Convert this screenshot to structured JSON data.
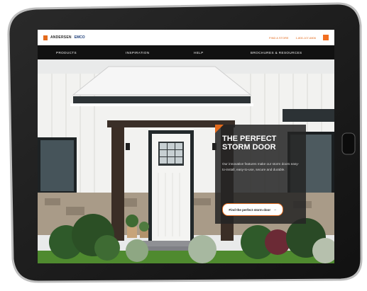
{
  "header": {
    "brand": "ANDERSEN",
    "brand_sub": "EMCO",
    "util_links": [
      "FIND A STORE",
      "1-800-107-6806"
    ]
  },
  "nav": {
    "items": [
      "PRODUCTS",
      "INSPIRATION",
      "HELP",
      "BROCHURES & RESOURCES"
    ]
  },
  "hero": {
    "title": "THE PERFECT STORM DOOR",
    "description": "Our innovative features make our storm doors easy-to-install, easy-to-use, secure and durable.",
    "cta_label": "Find the perfect storm door"
  },
  "colors": {
    "accent": "#e36a1c",
    "nav_bg": "#111111",
    "panel_bg": "#242424"
  },
  "icons": {
    "cta_arrow": "arrow-right-icon",
    "scroll_chevron": "chevron-down-icon"
  }
}
